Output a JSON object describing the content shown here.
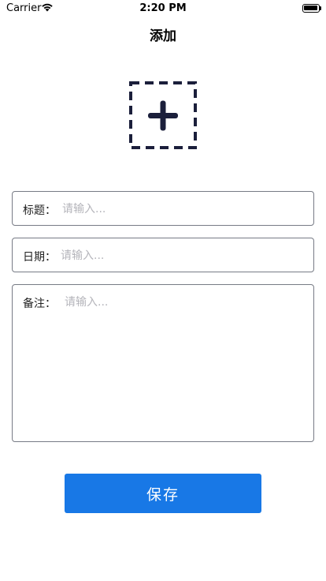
{
  "status_bar": {
    "carrier": "Carrier",
    "time": "2:20 PM",
    "wifi_icon": "wifi-icon",
    "battery_icon": "battery-icon"
  },
  "nav": {
    "title": "添加"
  },
  "image_picker": {
    "icon": "add-image-icon",
    "icon_color": "#1b1f3b"
  },
  "form": {
    "title": {
      "label": "标题：",
      "value": "",
      "placeholder": "请输入..."
    },
    "date": {
      "label": "日期：",
      "value": "",
      "placeholder": "请输入..."
    },
    "note": {
      "label": "备注：",
      "value": "",
      "placeholder": "请输入..."
    }
  },
  "actions": {
    "save_label": "保存",
    "save_color": "#1878e6"
  }
}
